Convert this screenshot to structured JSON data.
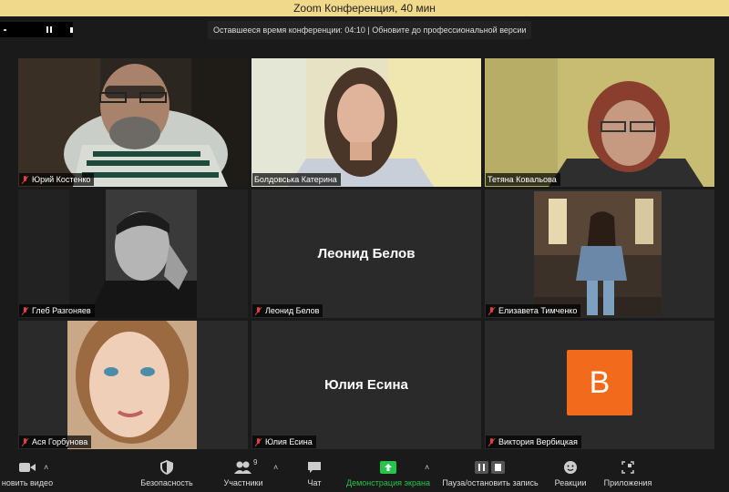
{
  "window": {
    "title": "Zoom Конференция, 40 мин"
  },
  "banner": {
    "text": "Оставшееся время конференции: 04:10 | Обновите до профессиональной версии"
  },
  "participants": [
    {
      "name": "Юрий Костенко",
      "muted": true,
      "video": true
    },
    {
      "name": "Болдовська Катерина",
      "muted": false,
      "video": true
    },
    {
      "name": "Тетяна Ковальова",
      "muted": false,
      "video": true
    },
    {
      "name": "Глеб Разгоняев",
      "muted": true,
      "video": true
    },
    {
      "name": "Леонид Белов",
      "muted": true,
      "video": false,
      "display_name": "Леонид Белов"
    },
    {
      "name": "Елизавета Тимченко",
      "muted": true,
      "video": true,
      "active_speaker": true
    },
    {
      "name": "Ася Горбунова",
      "muted": true,
      "video": true
    },
    {
      "name": "Юлия Есина",
      "muted": true,
      "video": false,
      "display_name": "Юлия Есина"
    },
    {
      "name": "Виктория Вербицкая",
      "muted": true,
      "video": false,
      "avatar_letter": "В"
    }
  ],
  "toolbar": {
    "video_label": "новить видео",
    "security_label": "Безопасность",
    "participants_label": "Участники",
    "participants_count": "9",
    "chat_label": "Чат",
    "share_label": "Демонстрация экрана",
    "record_label": "Пауза/остановить запись",
    "reactions_label": "Реакции",
    "apps_label": "Приложения"
  },
  "colors": {
    "accent_green": "#26c44a",
    "active_border": "#b5d84a",
    "avatar_orange": "#f26b1d",
    "title_bar": "#f1d98b"
  }
}
